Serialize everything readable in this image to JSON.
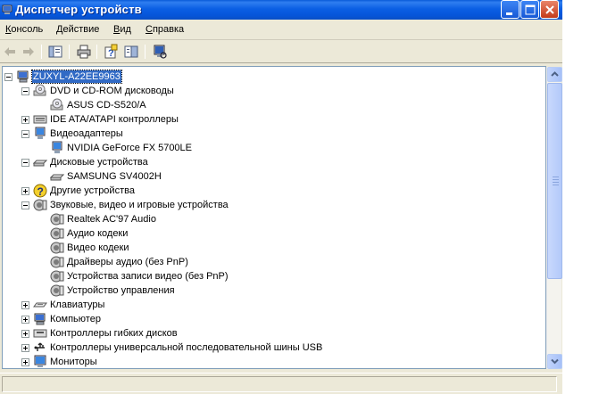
{
  "window": {
    "title": "Диспетчер устройств"
  },
  "menu": [
    {
      "label": "Консоль"
    },
    {
      "label": "Действие"
    },
    {
      "label": "Вид"
    },
    {
      "label": "Справка"
    }
  ],
  "toolbar": {
    "buttons": [
      "back-arrow-icon",
      "forward-arrow-icon",
      "show-hide-tree-icon",
      "print-icon",
      "properties-help-icon",
      "help-icon",
      "scan-hardware-icon"
    ]
  },
  "tree": {
    "root": "ZUXYL-A22EE9963",
    "items": [
      {
        "label": "DVD и CD-ROM дисководы",
        "icon": "cdrom-icon",
        "expander": "minus"
      },
      {
        "label": "ASUS CD-S520/A",
        "icon": "cdrom-icon",
        "expander": ""
      },
      {
        "label": "IDE ATA/ATAPI контроллеры",
        "icon": "ide-controller-icon",
        "expander": "plus"
      },
      {
        "label": "Видеоадаптеры",
        "icon": "display-adapter-icon",
        "expander": "minus"
      },
      {
        "label": "NVIDIA GeForce FX 5700LE",
        "icon": "display-adapter-icon",
        "expander": ""
      },
      {
        "label": "Дисковые устройства",
        "icon": "disk-drive-icon",
        "expander": "minus"
      },
      {
        "label": "SAMSUNG SV4002H",
        "icon": "disk-drive-icon",
        "expander": ""
      },
      {
        "label": "Другие устройства",
        "icon": "unknown-device-icon",
        "expander": "plus"
      },
      {
        "label": "Звуковые, видео и игровые устройства",
        "icon": "sound-device-icon",
        "expander": "minus"
      },
      {
        "label": "Realtek AC'97 Audio",
        "icon": "sound-device-icon",
        "expander": ""
      },
      {
        "label": "Аудио кодеки",
        "icon": "sound-device-icon",
        "expander": ""
      },
      {
        "label": "Видео кодеки",
        "icon": "sound-device-icon",
        "expander": ""
      },
      {
        "label": "Драйверы аудио (без PnP)",
        "icon": "sound-device-icon",
        "expander": ""
      },
      {
        "label": "Устройства записи видео (без PnP)",
        "icon": "sound-device-icon",
        "expander": ""
      },
      {
        "label": "Устройство управления",
        "icon": "sound-device-icon",
        "expander": ""
      },
      {
        "label": "Клавиатуры",
        "icon": "keyboard-icon",
        "expander": "plus"
      },
      {
        "label": "Компьютер",
        "icon": "computer-icon",
        "expander": "plus"
      },
      {
        "label": "Контроллеры гибких дисков",
        "icon": "floppy-controller-icon",
        "expander": "plus"
      },
      {
        "label": "Контроллеры универсальной последовательной шины USB",
        "icon": "usb-icon",
        "expander": "plus"
      },
      {
        "label": "Мониторы",
        "icon": "monitor-icon",
        "expander": "plus"
      }
    ]
  },
  "colors": {
    "titlebar": "#0b5fe4",
    "selection": "#316ac5",
    "chrome": "#ece9d8"
  }
}
